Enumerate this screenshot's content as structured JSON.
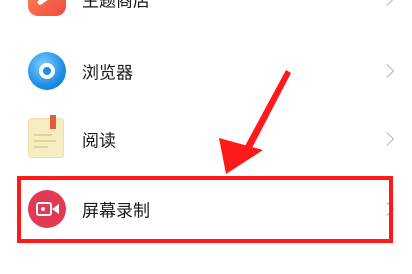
{
  "settings_list": {
    "items": [
      {
        "label": "主题商店",
        "icon": "theme-store-icon"
      },
      {
        "label": "浏览器",
        "icon": "browser-icon"
      },
      {
        "label": "阅读",
        "icon": "reader-icon"
      },
      {
        "label": "屏幕录制",
        "icon": "screen-record-icon"
      }
    ]
  },
  "annotation": {
    "highlight_color": "#ff1a1a",
    "arrow_color": "#ff1a1a"
  }
}
